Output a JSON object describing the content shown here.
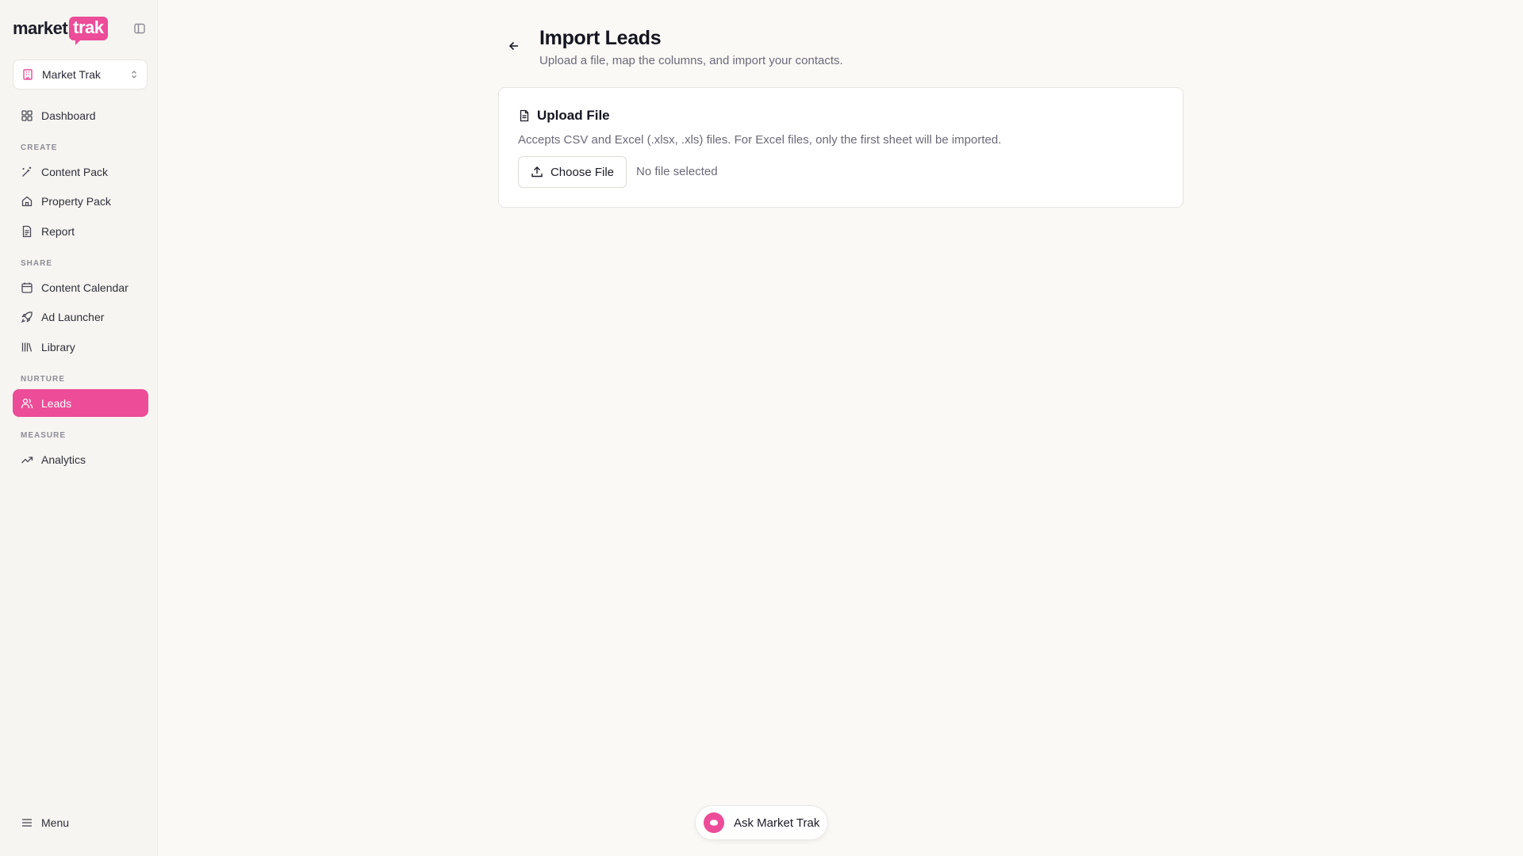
{
  "brand": {
    "logo_market": "market",
    "logo_trak": "trak",
    "accent_color": "#ec4c98"
  },
  "sidebar": {
    "workspace": {
      "label": "Market Trak",
      "icon": "building-icon"
    },
    "items": {
      "dashboard": {
        "label": "Dashboard",
        "icon": "grid-icon"
      },
      "create_section": "CREATE",
      "content_pack": {
        "label": "Content Pack",
        "icon": "magic-wand-icon"
      },
      "property_pack": {
        "label": "Property Pack",
        "icon": "home-icon"
      },
      "report": {
        "label": "Report",
        "icon": "document-icon"
      },
      "share_section": "SHARE",
      "content_calendar": {
        "label": "Content Calendar",
        "icon": "calendar-icon"
      },
      "ad_launcher": {
        "label": "Ad Launcher",
        "icon": "rocket-icon"
      },
      "library": {
        "label": "Library",
        "icon": "library-icon"
      },
      "nurture_section": "NURTURE",
      "leads": {
        "label": "Leads",
        "icon": "users-icon",
        "active": true
      },
      "measure_section": "MEASURE",
      "analytics": {
        "label": "Analytics",
        "icon": "trending-up-icon"
      }
    },
    "menu": {
      "label": "Menu",
      "icon": "hamburger-icon"
    }
  },
  "header": {
    "title": "Import Leads",
    "subtitle": "Upload a file, map the columns, and import your contacts."
  },
  "upload_card": {
    "title": "Upload File",
    "description": "Accepts CSV and Excel (.xlsx, .xls) files. For Excel files, only the first sheet will be imported.",
    "choose_label": "Choose File",
    "status": "No file selected"
  },
  "assistant": {
    "label": "Ask Market Trak"
  }
}
